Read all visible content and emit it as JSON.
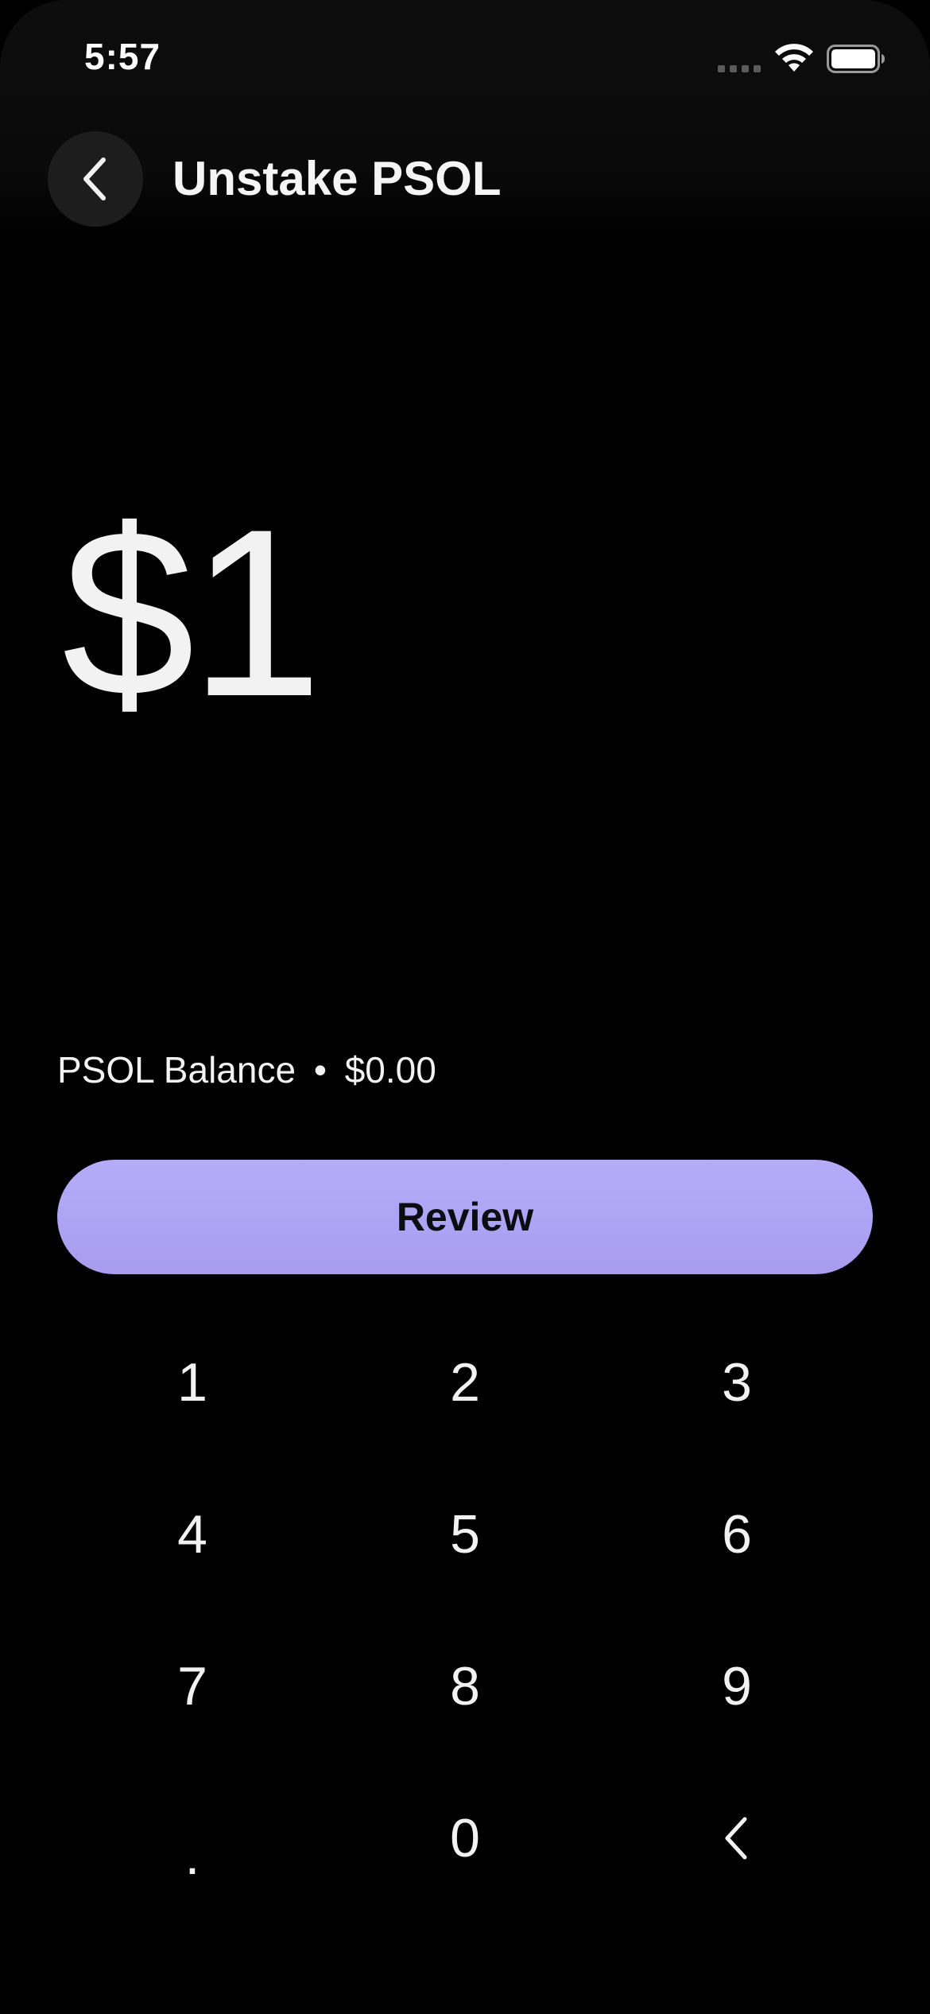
{
  "status_bar": {
    "time": "5:57",
    "icons": [
      "cellular-signal-icon",
      "wifi-icon",
      "battery-icon"
    ]
  },
  "header": {
    "back_icon": "chevron-left-icon",
    "title": "Unstake PSOL"
  },
  "amount": {
    "display": "$1"
  },
  "balance": {
    "label": "PSOL Balance",
    "separator": "•",
    "value": "$0.00"
  },
  "review_button": {
    "label": "Review",
    "color": "#b1a5f5"
  },
  "keypad": {
    "keys": [
      "1",
      "2",
      "3",
      "4",
      "5",
      "6",
      "7",
      "8",
      "9",
      ".",
      "0"
    ],
    "backspace_icon": "chevron-left-icon"
  },
  "colors": {
    "background": "#000000",
    "accent": "#b1a5f5",
    "text": "#f2f2f2",
    "back_button_bg": "#1d1d1d"
  }
}
